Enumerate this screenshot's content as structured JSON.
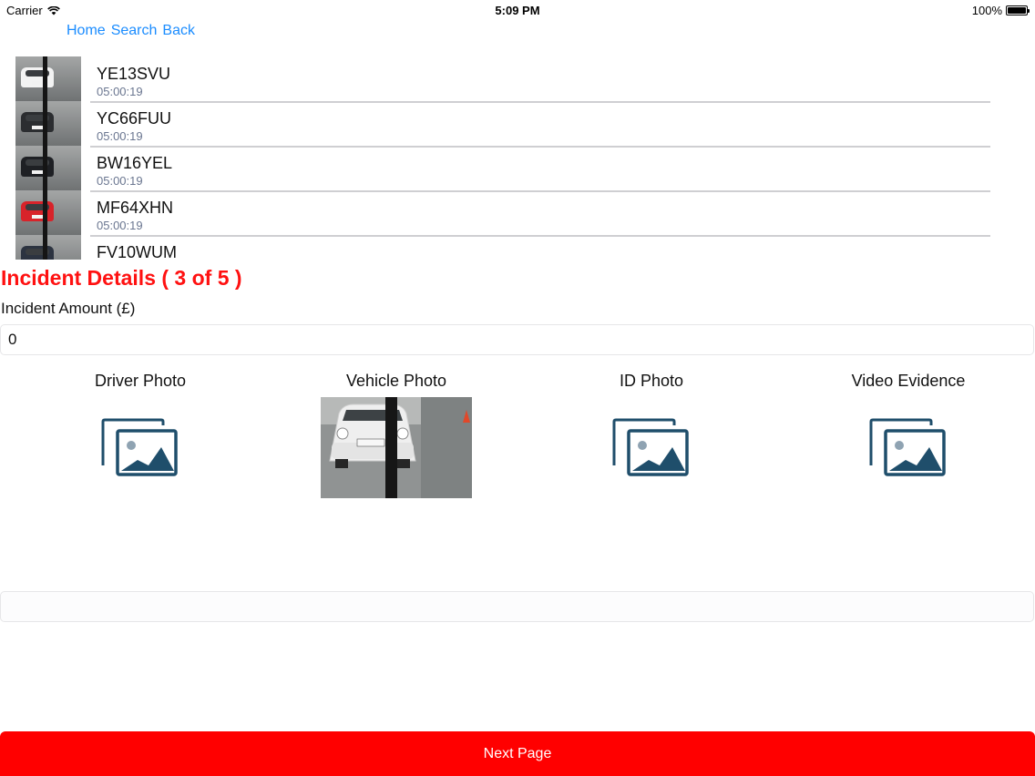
{
  "status_bar": {
    "carrier": "Carrier",
    "time": "5:09 PM",
    "battery": "100%"
  },
  "nav": {
    "home": "Home",
    "search": "Search",
    "back": "Back"
  },
  "vehicles": [
    {
      "plate": "YE13SVU",
      "time": "05:00:19",
      "car_color": "#f3f3f3"
    },
    {
      "plate": "YC66FUU",
      "time": "05:00:19",
      "car_color": "#2b2d30"
    },
    {
      "plate": "BW16YEL",
      "time": "05:00:19",
      "car_color": "#1e2024"
    },
    {
      "plate": "MF64XHN",
      "time": "05:00:19",
      "car_color": "#d8232a"
    },
    {
      "plate": "FV10WUM",
      "time": "",
      "car_color": "#2c3340"
    }
  ],
  "incident": {
    "title": "Incident Details ( 3 of 5 )",
    "amount_label": "Incident Amount (£)",
    "amount_value": "0"
  },
  "photos": {
    "driver": "Driver Photo",
    "vehicle": "Vehicle Photo",
    "id": "ID Photo",
    "video": "Video Evidence"
  },
  "next_button": "Next Page",
  "colors": {
    "accent": "#ff0000",
    "link": "#1a8cff",
    "icon": "#1f4e6b"
  }
}
